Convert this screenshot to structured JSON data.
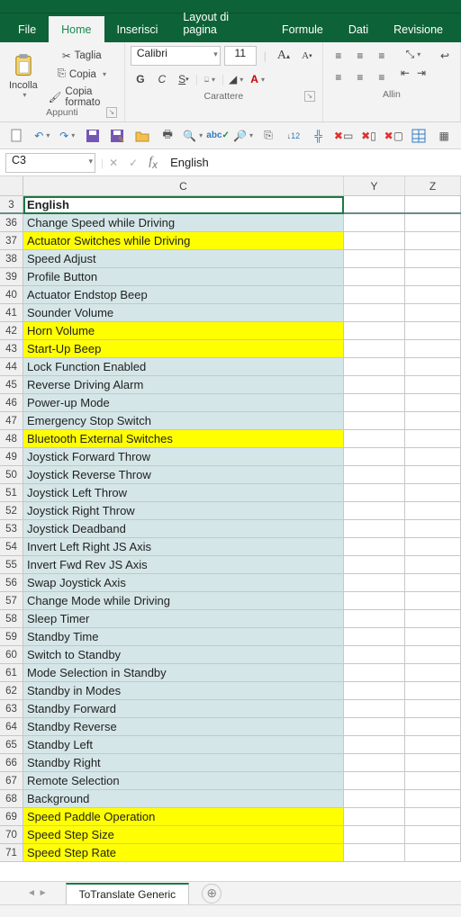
{
  "tabs": [
    "File",
    "Home",
    "Inserisci",
    "Layout di pagina",
    "Formule",
    "Dati",
    "Revisione"
  ],
  "active_tab": "Home",
  "clipboard": {
    "paste": "Incolla",
    "cut": "Taglia",
    "copy": "Copia",
    "format": "Copia formato",
    "group": "Appunti"
  },
  "font": {
    "name": "Calibri",
    "size": "11",
    "group": "Carattere"
  },
  "align": {
    "group": "Allin"
  },
  "namebox": "C3",
  "fx_value": "English",
  "cols": [
    "C",
    "Y",
    "Z"
  ],
  "header_row": {
    "num": 3,
    "value": "English"
  },
  "rows": [
    {
      "n": 36,
      "t": "Change Speed while Driving",
      "h": false
    },
    {
      "n": 37,
      "t": "Actuator Switches while Driving",
      "h": true
    },
    {
      "n": 38,
      "t": "Speed Adjust",
      "h": false
    },
    {
      "n": 39,
      "t": "Profile Button",
      "h": false
    },
    {
      "n": 40,
      "t": "Actuator Endstop Beep",
      "h": false
    },
    {
      "n": 41,
      "t": "Sounder Volume",
      "h": false
    },
    {
      "n": 42,
      "t": "Horn Volume",
      "h": true
    },
    {
      "n": 43,
      "t": "Start-Up Beep",
      "h": true
    },
    {
      "n": 44,
      "t": "Lock Function Enabled",
      "h": false
    },
    {
      "n": 45,
      "t": "Reverse Driving Alarm",
      "h": false
    },
    {
      "n": 46,
      "t": "Power-up Mode",
      "h": false
    },
    {
      "n": 47,
      "t": "Emergency Stop Switch",
      "h": false
    },
    {
      "n": 48,
      "t": "Bluetooth External Switches",
      "h": true
    },
    {
      "n": 49,
      "t": "Joystick Forward Throw",
      "h": false
    },
    {
      "n": 50,
      "t": "Joystick Reverse Throw",
      "h": false
    },
    {
      "n": 51,
      "t": "Joystick Left Throw",
      "h": false
    },
    {
      "n": 52,
      "t": "Joystick Right Throw",
      "h": false
    },
    {
      "n": 53,
      "t": "Joystick Deadband",
      "h": false
    },
    {
      "n": 54,
      "t": "Invert Left Right JS Axis",
      "h": false
    },
    {
      "n": 55,
      "t": "Invert Fwd Rev JS Axis",
      "h": false
    },
    {
      "n": 56,
      "t": "Swap Joystick Axis",
      "h": false
    },
    {
      "n": 57,
      "t": "Change Mode while Driving",
      "h": false
    },
    {
      "n": 58,
      "t": "Sleep Timer",
      "h": false
    },
    {
      "n": 59,
      "t": "Standby Time",
      "h": false
    },
    {
      "n": 60,
      "t": "Switch to Standby",
      "h": false
    },
    {
      "n": 61,
      "t": "Mode Selection in Standby",
      "h": false
    },
    {
      "n": 62,
      "t": "Standby in Modes",
      "h": false
    },
    {
      "n": 63,
      "t": "Standby Forward",
      "h": false
    },
    {
      "n": 64,
      "t": "Standby Reverse",
      "h": false
    },
    {
      "n": 65,
      "t": "Standby Left",
      "h": false
    },
    {
      "n": 66,
      "t": "Standby Right",
      "h": false
    },
    {
      "n": 67,
      "t": "Remote Selection",
      "h": false
    },
    {
      "n": 68,
      "t": "Background",
      "h": false
    },
    {
      "n": 69,
      "t": "Speed Paddle Operation",
      "h": true
    },
    {
      "n": 70,
      "t": "Speed Step Size",
      "h": true
    },
    {
      "n": 71,
      "t": "Speed Step Rate",
      "h": true
    }
  ],
  "sheet": "ToTranslate Generic"
}
